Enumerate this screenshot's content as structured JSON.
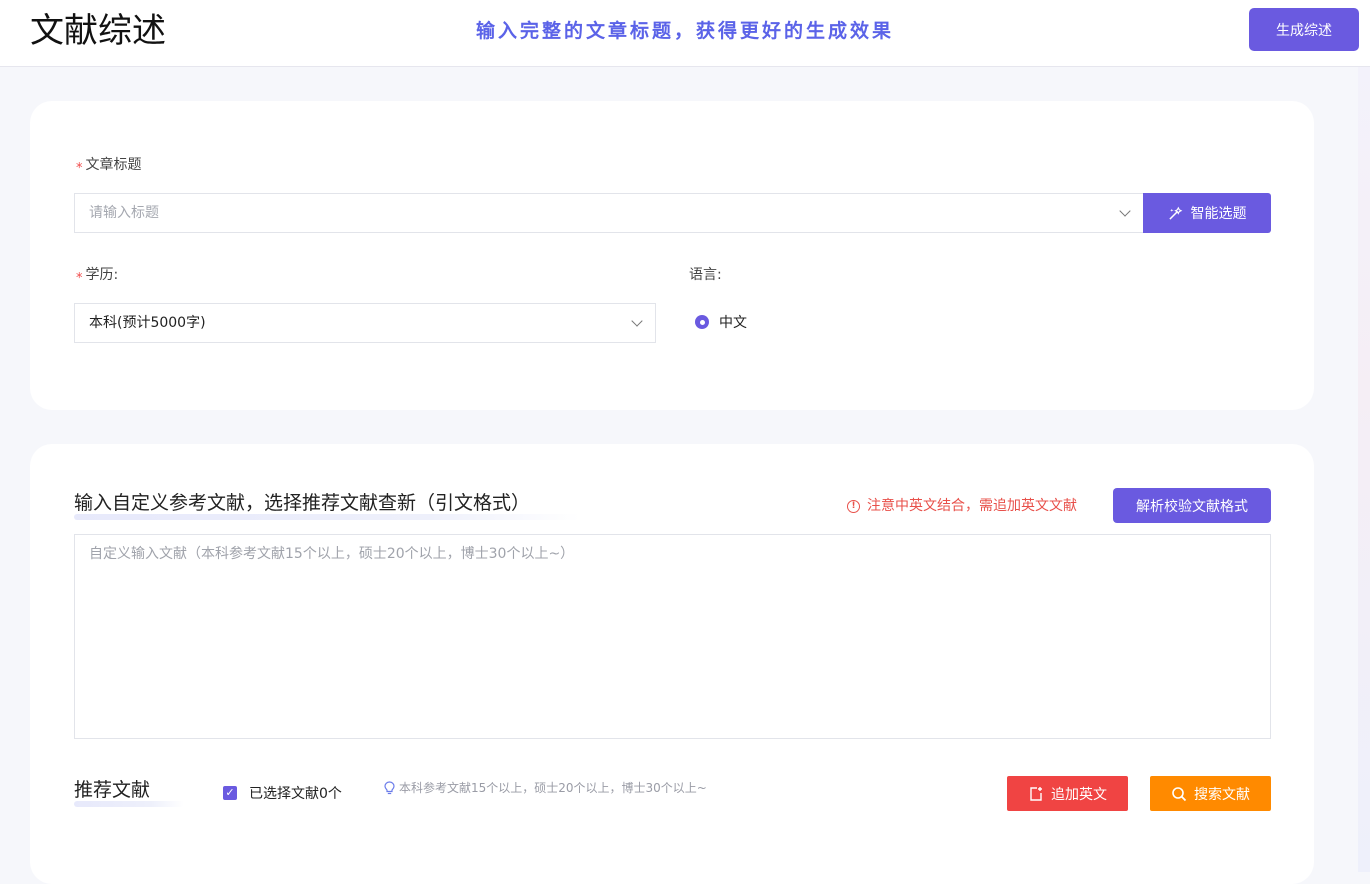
{
  "header": {
    "app_title": "文献综述",
    "hint": "输入完整的文章标题，获得更好的生成效果",
    "generate_button": "生成综述"
  },
  "form": {
    "title_label": "文章标题",
    "title_placeholder": "请输入标题",
    "smart_button": "智能选题",
    "education_label": "学历:",
    "education_value": "本科(预计5000字)",
    "language_label": "语言:",
    "language_option": "中文"
  },
  "references": {
    "section_title": "输入自定义参考文献，选择推荐文献查新（引文格式）",
    "warning": "注意中英文结合，需追加英文文献",
    "parse_button": "解析校验文献格式",
    "textarea_placeholder": "自定义输入文献（本科参考文献15个以上，硕士20个以上，博士30个以上~）",
    "recommend_title": "推荐文献",
    "selected_label": "已选择文献0个",
    "tip": "本科参考文献15个以上，硕士20个以上，博士30个以上~",
    "add_english_button": "追加英文",
    "search_button": "搜索文献"
  },
  "colors": {
    "primary": "#6a5ae0",
    "danger": "#f04443",
    "warning": "#ff8a00",
    "hint": "#5b63e8"
  }
}
